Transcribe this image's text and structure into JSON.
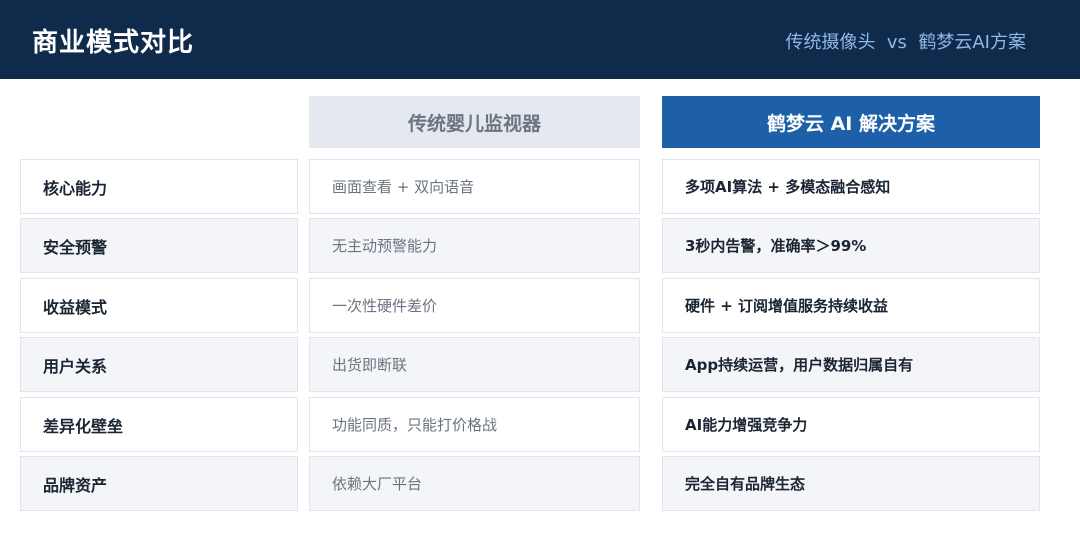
{
  "header": {
    "title": "商业模式对比",
    "subtitle": "传统摄像头  vs  鹤梦云AI方案"
  },
  "columns": {
    "traditional": "传统婴儿监视器",
    "ai": "鹤梦云 AI 解决方案"
  },
  "rows": [
    {
      "label": "核心能力",
      "traditional": "画面查看 + 双向语音",
      "ai": "多项AI算法 + 多模态融合感知"
    },
    {
      "label": "安全预警",
      "traditional": "无主动预警能力",
      "ai": "3秒内告警，准确率＞99%"
    },
    {
      "label": "收益模式",
      "traditional": "一次性硬件差价",
      "ai": "硬件 + 订阅增值服务持续收益"
    },
    {
      "label": "用户关系",
      "traditional": "出货即断联",
      "ai": "App持续运营，用户数据归属自有"
    },
    {
      "label": "差异化壁垒",
      "traditional": "功能同质，只能打价格战",
      "ai": "AI能力增强竞争力"
    },
    {
      "label": "品牌资产",
      "traditional": "依赖大厂平台",
      "ai": "完全自有品牌生态"
    }
  ],
  "colors": {
    "header_bg": "#0f2a4a",
    "accent_blue": "#1d5fa8",
    "subtitle_blue": "#8fb8e8"
  }
}
